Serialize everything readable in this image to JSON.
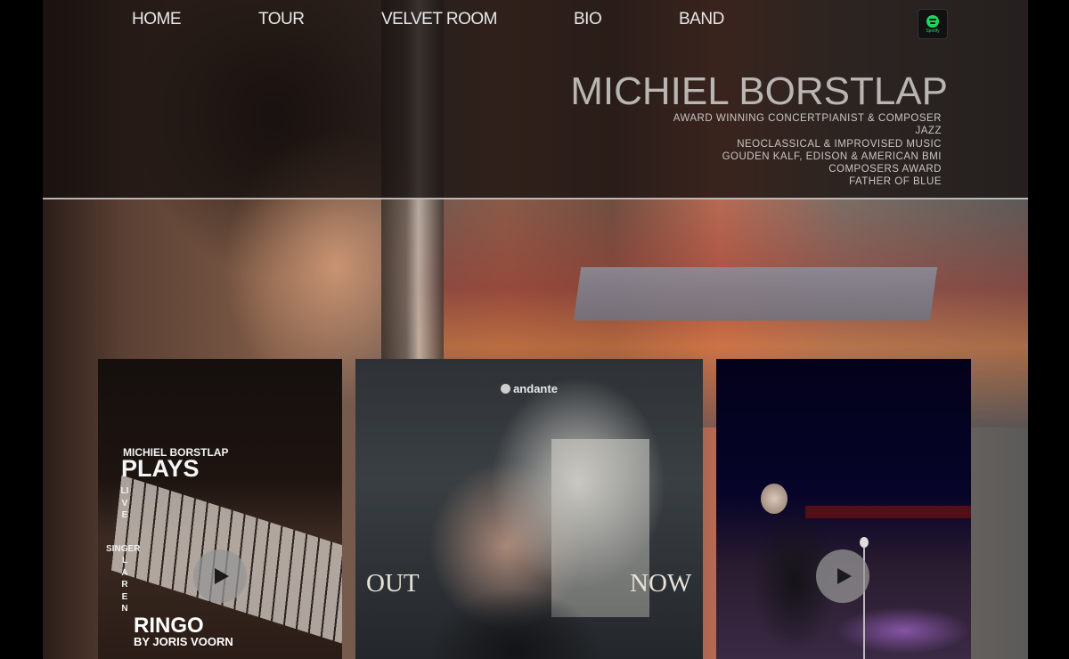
{
  "nav": {
    "items": [
      {
        "label": "HOME"
      },
      {
        "label": "TOUR"
      },
      {
        "label": "VELVET ROOM"
      },
      {
        "label": "BIO"
      },
      {
        "label": "BAND"
      }
    ],
    "spotify": {
      "label": "Spotify",
      "icon": "spotify-icon",
      "color": "#1ed760"
    }
  },
  "hero": {
    "title": "MICHIEL BORSTLAP",
    "taglines": [
      "AWARD WINNING CONCERTPIANIST & COMPOSER",
      "JAZZ",
      "NEOCLASSICAL & IMPROVISED MUSIC",
      "GOUDEN KALF, EDISON & AMERICAN BMI",
      "COMPOSERS AWARD",
      "FATHER OF BLUE"
    ]
  },
  "cards": [
    {
      "subtitle": "MICHIEL BORSTLAP",
      "heading": "PLAYS",
      "vertical_live": "LIVE",
      "singer": "SINGER",
      "vertical_name": "LAREN",
      "ringo": "RINGO",
      "credit": "BY JORIS VOORN",
      "play_icon": "play-icon"
    },
    {
      "brand": "andante",
      "left_text": "OUT",
      "right_text": "NOW"
    },
    {
      "play_icon": "play-icon"
    }
  ]
}
